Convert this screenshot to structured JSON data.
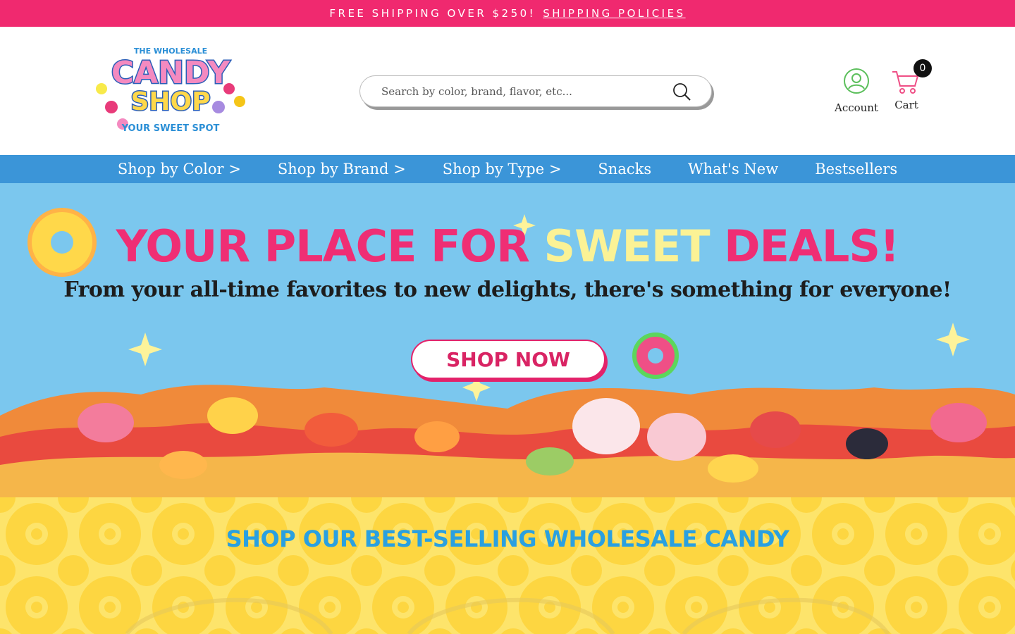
{
  "announcement": {
    "text": "FREE SHIPPING OVER $250!",
    "link": "SHIPPING POLICIES"
  },
  "header": {
    "logo_text": {
      "top": "THE WHOLESALE",
      "line1": "CANDY",
      "line2": "SHOP",
      "tagline": "YOUR SWEET SPOT"
    },
    "search": {
      "placeholder": "Search by color, brand, flavor, etc..."
    },
    "account_label": "Account",
    "cart_label": "Cart",
    "cart_count": "0"
  },
  "nav": {
    "items": [
      {
        "label": "Shop by Color >"
      },
      {
        "label": "Shop by Brand >"
      },
      {
        "label": "Shop by Type >"
      },
      {
        "label": "Snacks"
      },
      {
        "label": "What's New"
      },
      {
        "label": "Bestsellers"
      }
    ]
  },
  "hero": {
    "title_part1": "YOUR PLACE FOR ",
    "title_part2": "SWEET",
    "title_part3": " DEALS!",
    "subtitle": "From your all-time favorites to new delights, there's something for everyone!",
    "cta": "SHOP NOW"
  },
  "bestsellers": {
    "title": "SHOP OUR BEST-SELLING WHOLESALE CANDY"
  },
  "colors": {
    "announce_bg": "#f0296f",
    "nav_bg": "#3b95d8",
    "hero_bg": "#7bc7ee",
    "accent_pink": "#ef2e74",
    "accent_yellow": "#fbf295",
    "section_yellow": "#fde46b",
    "section_title_blue": "#2aa0e0"
  }
}
